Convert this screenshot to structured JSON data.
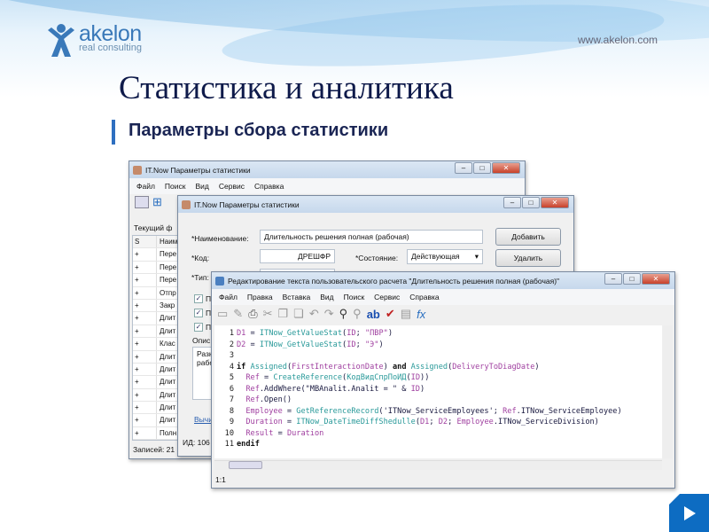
{
  "header": {
    "logo_name": "akelon",
    "logo_tagline": "real consulting",
    "url": "www.akelon.com"
  },
  "slide": {
    "title": "Статистика и аналитика",
    "subtitle": "Параметры сбора статистики"
  },
  "win1": {
    "title": "IT.Now Параметры статистики",
    "menu": [
      "Файл",
      "Поиск",
      "Вид",
      "Сервис",
      "Справка"
    ],
    "filter_label": "Текущий ф",
    "col_s": "S",
    "col_name": "Наим",
    "rows": [
      [
        "+",
        "Пере"
      ],
      [
        "+",
        "Пере"
      ],
      [
        "+",
        "Пере"
      ],
      [
        "+",
        "Отпр"
      ],
      [
        "+",
        "Закр"
      ],
      [
        "+",
        "Длит"
      ],
      [
        "+",
        "Длит"
      ],
      [
        "+",
        "Клас"
      ],
      [
        "+",
        "Длит"
      ],
      [
        "+",
        "Длит"
      ],
      [
        "+",
        "Длит"
      ],
      [
        "+",
        "Длит"
      ],
      [
        "+",
        "Длит"
      ],
      [
        "+",
        "Длит"
      ],
      [
        "+",
        "Полн"
      ]
    ],
    "status": "Записей: 21"
  },
  "win2": {
    "title": "IT.Now Параметры статистики",
    "name_label": "*Наименование:",
    "name_value": "Длительность решения полная (рабочая)",
    "code_label": "*Код:",
    "code_value": "ДРЕШФР",
    "state_label": "*Состояние:",
    "state_value": "Действующая",
    "type_label": "*Тип:",
    "add_button": "Добавить",
    "delete_button": "Удалить",
    "checks": [
      "П",
      "П",
      "П"
    ],
    "desc_label": "Опис",
    "desc_text": "Разн\nрабо",
    "calc_link": "Вычи",
    "id_label": "ИД: 106"
  },
  "win3": {
    "title": "Редактирование текста пользовательского расчета \"Длительность решения полная (рабочая)\"",
    "menu": [
      "Файл",
      "Правка",
      "Вставка",
      "Вид",
      "Поиск",
      "Сервис",
      "Справка"
    ],
    "code": [
      [
        [
          "D1",
          "v"
        ],
        [
          " = ",
          "t"
        ],
        [
          "ITNow_GetValueStat",
          "f"
        ],
        [
          "(",
          "t"
        ],
        [
          "ID",
          "v"
        ],
        [
          "; ",
          "t"
        ],
        [
          "\"ПВР\"",
          "v"
        ],
        [
          ")",
          "t"
        ]
      ],
      [
        [
          "D2",
          "v"
        ],
        [
          " = ",
          "t"
        ],
        [
          "ITNow_GetValueStat",
          "f"
        ],
        [
          "(",
          "t"
        ],
        [
          "ID",
          "v"
        ],
        [
          "; ",
          "t"
        ],
        [
          "\"Э\"",
          "v"
        ],
        [
          ")",
          "t"
        ]
      ],
      [],
      [
        [
          "if ",
          "k"
        ],
        [
          "Assigned",
          "f"
        ],
        [
          "(",
          "t"
        ],
        [
          "FirstInteractionDate",
          "v"
        ],
        [
          ") ",
          "t"
        ],
        [
          "and ",
          "k"
        ],
        [
          "Assigned",
          "f"
        ],
        [
          "(",
          "t"
        ],
        [
          "DeliveryToDiagDate",
          "v"
        ],
        [
          ")",
          "t"
        ]
      ],
      [
        [
          "  Ref",
          "v"
        ],
        [
          " = ",
          "t"
        ],
        [
          "CreateReference",
          "f"
        ],
        [
          "(",
          "t"
        ],
        [
          "КодВидСпрПоИД",
          "f"
        ],
        [
          "(",
          "t"
        ],
        [
          "ID",
          "v"
        ],
        [
          "))",
          "t"
        ]
      ],
      [
        [
          "  Ref",
          "v"
        ],
        [
          ".AddWhere(\"MBAnalit.Analit = \" & ",
          "t"
        ],
        [
          "ID",
          "v"
        ],
        [
          ")",
          "t"
        ]
      ],
      [
        [
          "  Ref",
          "v"
        ],
        [
          ".Open()",
          "t"
        ]
      ],
      [
        [
          "  Employee",
          "v"
        ],
        [
          " = ",
          "t"
        ],
        [
          "GetReferenceRecord",
          "f"
        ],
        [
          "('ITNow_ServiceEmployees'; ",
          "t"
        ],
        [
          "Ref",
          "v"
        ],
        [
          ".ITNow_ServiceEmployee)",
          "t"
        ]
      ],
      [
        [
          "  Duration",
          "v"
        ],
        [
          " = ",
          "t"
        ],
        [
          "ITNow_DateTimeDiffShedulle",
          "f"
        ],
        [
          "(",
          "t"
        ],
        [
          "D1",
          "v"
        ],
        [
          "; ",
          "t"
        ],
        [
          "D2",
          "v"
        ],
        [
          "; ",
          "t"
        ],
        [
          "Employee",
          "v"
        ],
        [
          ".ITNow_ServiceDivision)",
          "t"
        ]
      ],
      [
        [
          "  Result",
          "v"
        ],
        [
          " = ",
          "t"
        ],
        [
          "Duration",
          "v"
        ]
      ],
      [
        [
          "endif",
          "k"
        ]
      ]
    ],
    "status": "1:1"
  }
}
